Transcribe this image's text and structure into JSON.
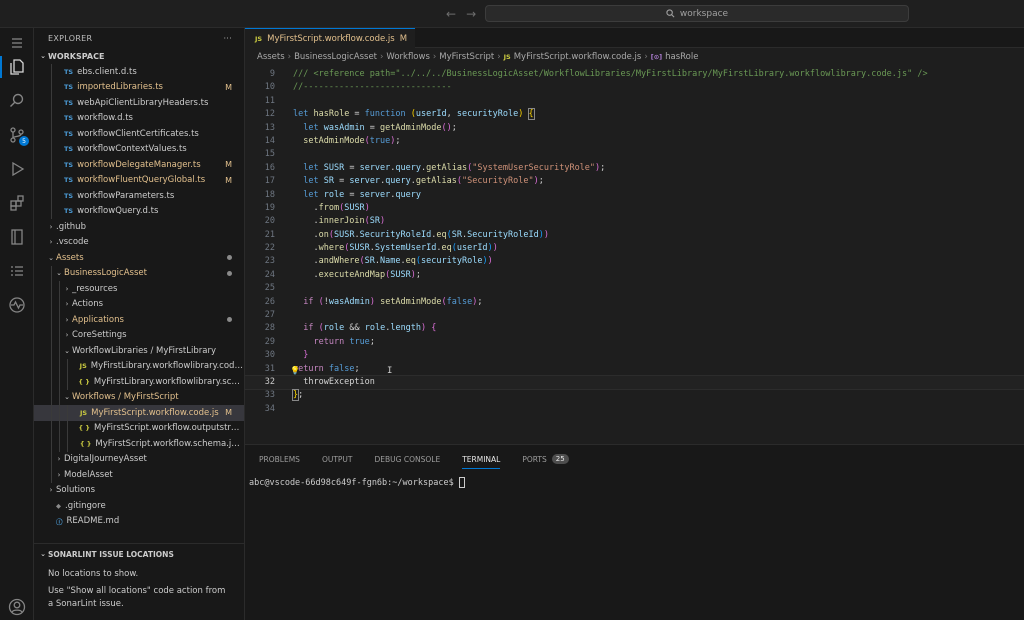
{
  "titlebar": {
    "search_text": "workspace"
  },
  "activity": {
    "scm_badge": "5"
  },
  "explorer": {
    "title": "EXPLORER",
    "more": "···",
    "workspace_label": "WORKSPACE",
    "rows": [
      {
        "name": "ebs.client.d.ts",
        "icon": "TS",
        "kind": "ts",
        "depth": 2,
        "chev": ""
      },
      {
        "name": "importedLibraries.ts",
        "icon": "TS",
        "kind": "ts",
        "depth": 2,
        "chev": "",
        "deco": "M",
        "modified": true
      },
      {
        "name": "webApiClientLibraryHeaders.ts",
        "icon": "TS",
        "kind": "ts",
        "depth": 2,
        "chev": ""
      },
      {
        "name": "workflow.d.ts",
        "icon": "TS",
        "kind": "ts",
        "depth": 2,
        "chev": ""
      },
      {
        "name": "workflowClientCertificates.ts",
        "icon": "TS",
        "kind": "ts",
        "depth": 2,
        "chev": ""
      },
      {
        "name": "workflowContextValues.ts",
        "icon": "TS",
        "kind": "ts",
        "depth": 2,
        "chev": ""
      },
      {
        "name": "workflowDelegateManager.ts",
        "icon": "TS",
        "kind": "ts",
        "depth": 2,
        "chev": "",
        "deco": "M",
        "modified": true
      },
      {
        "name": "workflowFluentQueryGlobal.ts",
        "icon": "TS",
        "kind": "ts",
        "depth": 2,
        "chev": "",
        "deco": "M",
        "modified": true
      },
      {
        "name": "workflowParameters.ts",
        "icon": "TS",
        "kind": "ts",
        "depth": 2,
        "chev": ""
      },
      {
        "name": "workflowQuery.d.ts",
        "icon": "TS",
        "kind": "ts",
        "depth": 2,
        "chev": ""
      },
      {
        "name": ".github",
        "icon": "",
        "kind": "folder",
        "depth": 1,
        "chev": "›"
      },
      {
        "name": ".vscode",
        "icon": "",
        "kind": "folder",
        "depth": 1,
        "chev": "›"
      },
      {
        "name": "Assets",
        "icon": "",
        "kind": "folder",
        "depth": 1,
        "chev": "⌄",
        "dot": true,
        "modified": true
      },
      {
        "name": "BusinessLogicAsset",
        "icon": "",
        "kind": "folder",
        "depth": 2,
        "chev": "⌄",
        "dot": true,
        "modified": true
      },
      {
        "name": "_resources",
        "icon": "",
        "kind": "folder",
        "depth": 3,
        "chev": "›"
      },
      {
        "name": "Actions",
        "icon": "",
        "kind": "folder",
        "depth": 3,
        "chev": "›"
      },
      {
        "name": "Applications",
        "icon": "",
        "kind": "folder",
        "depth": 3,
        "chev": "›",
        "dot": true,
        "modified": true
      },
      {
        "name": "CoreSettings",
        "icon": "",
        "kind": "folder",
        "depth": 3,
        "chev": "›"
      },
      {
        "name": "WorkflowLibraries / MyFirstLibrary",
        "icon": "",
        "kind": "folder",
        "depth": 3,
        "chev": "⌄"
      },
      {
        "name": "MyFirstLibrary.workflowlibrary.code.js",
        "icon": "JS",
        "kind": "js",
        "depth": 4,
        "chev": ""
      },
      {
        "name": "MyFirstLibrary.workflowlibrary.schema.js...",
        "icon": "{ }",
        "kind": "json",
        "depth": 4,
        "chev": ""
      },
      {
        "name": "Workflows / MyFirstScript",
        "icon": "",
        "kind": "folder",
        "depth": 3,
        "chev": "⌄",
        "modified": true
      },
      {
        "name": "MyFirstScript.workflow.code.js",
        "icon": "JS",
        "kind": "js",
        "depth": 4,
        "chev": "",
        "deco": "M",
        "modified": true,
        "selected": true
      },
      {
        "name": "MyFirstScript.workflow.outputstructurec...",
        "icon": "{ }",
        "kind": "json",
        "depth": 4,
        "chev": ""
      },
      {
        "name": "MyFirstScript.workflow.schema.json",
        "icon": "{ }",
        "kind": "json",
        "depth": 4,
        "chev": ""
      },
      {
        "name": "DigitalJourneyAsset",
        "icon": "",
        "kind": "folder",
        "depth": 2,
        "chev": "›"
      },
      {
        "name": "ModelAsset",
        "icon": "",
        "kind": "folder",
        "depth": 2,
        "chev": "›"
      },
      {
        "name": "Solutions",
        "icon": "",
        "kind": "folder",
        "depth": 1,
        "chev": "›"
      },
      {
        "name": ".gitingore",
        "icon": "◆",
        "kind": "git",
        "depth": 1,
        "chev": ""
      },
      {
        "name": "README.md",
        "icon": "ⓘ",
        "kind": "info",
        "depth": 1,
        "chev": ""
      }
    ]
  },
  "sonar": {
    "title": "SONARLINT ISSUE LOCATIONS",
    "line1": "No locations to show.",
    "line2": "Use \"Show all locations\" code action from a SonarLint issue."
  },
  "editor": {
    "tab": {
      "icon": "JS",
      "label": "MyFirstScript.workflow.code.js",
      "status": "M",
      "close": ""
    },
    "breadcrumb": [
      "Assets",
      "BusinessLogicAsset",
      "Workflows",
      "MyFirstScript",
      "MyFirstScript.workflow.code.js",
      "hasRole"
    ],
    "breadcrumb_icons": [
      "JS",
      "[⊙]"
    ],
    "current_line": 32,
    "lines": [
      {
        "n": 9,
        "t": "<span class=\"cm\">/// &lt;reference path=\"../../../BusinessLogicAsset/WorkflowLibraries/MyFirstLibrary/MyFirstLibrary.workflowlibrary.code.js\" /&gt;</span>"
      },
      {
        "n": 10,
        "t": "<span class=\"cm\">//-----------------------------</span>"
      },
      {
        "n": 11,
        "t": ""
      },
      {
        "n": 12,
        "t": "<span class=\"k\">let</span> <span class=\"f\">hasRole</span> = <span class=\"k\">function</span> <span class=\"b1\">(</span><span class=\"v\">userId</span>, <span class=\"v\">securityRole</span><span class=\"b1\">)</span> <span class=\"b1\" style=\"outline:1px solid #888\">{</span>"
      },
      {
        "n": 13,
        "t": "  <span class=\"k\">let</span> <span class=\"v\">wasAdmin</span> = <span class=\"f\">getAdminMode</span><span class=\"b2\">()</span>;"
      },
      {
        "n": 14,
        "t": "  <span class=\"f\">setAdminMode</span><span class=\"b2\">(</span><span class=\"k\">true</span><span class=\"b2\">)</span>;"
      },
      {
        "n": 15,
        "t": ""
      },
      {
        "n": 16,
        "t": "  <span class=\"k\">let</span> <span class=\"v\">SUSR</span> = <span class=\"v\">server</span>.<span class=\"v\">query</span>.<span class=\"f\">getAlias</span><span class=\"b2\">(</span><span class=\"s\">\"SystemUserSecurityRole\"</span><span class=\"b2\">)</span>;"
      },
      {
        "n": 17,
        "t": "  <span class=\"k\">let</span> <span class=\"v\">SR</span> = <span class=\"v\">server</span>.<span class=\"v\">query</span>.<span class=\"f\">getAlias</span><span class=\"b2\">(</span><span class=\"s\">\"SecurityRole\"</span><span class=\"b2\">)</span>;"
      },
      {
        "n": 18,
        "t": "  <span class=\"k\">let</span> <span class=\"v\">role</span> = <span class=\"v\">server</span>.<span class=\"v\">query</span>"
      },
      {
        "n": 19,
        "t": "    .<span class=\"f\">from</span><span class=\"b2\">(</span><span class=\"v\">SUSR</span><span class=\"b2\">)</span>"
      },
      {
        "n": 20,
        "t": "    .<span class=\"f\">innerJoin</span><span class=\"b2\">(</span><span class=\"v\">SR</span><span class=\"b2\">)</span>"
      },
      {
        "n": 21,
        "t": "    .<span class=\"f\">on</span><span class=\"b2\">(</span><span class=\"v\">SUSR</span>.<span class=\"v\">SecurityRoleId</span>.<span class=\"f\">eq</span><span class=\"b3\">(</span><span class=\"v\">SR</span>.<span class=\"v\">SecurityRoleId</span><span class=\"b3\">)</span><span class=\"b2\">)</span>"
      },
      {
        "n": 22,
        "t": "    .<span class=\"f\">where</span><span class=\"b2\">(</span><span class=\"v\">SUSR</span>.<span class=\"v\">SystemUserId</span>.<span class=\"f\">eq</span><span class=\"b3\">(</span><span class=\"v\">userId</span><span class=\"b3\">)</span><span class=\"b2\">)</span>"
      },
      {
        "n": 23,
        "t": "    .<span class=\"f\">andWhere</span><span class=\"b2\">(</span><span class=\"v\">SR</span>.<span class=\"v\">Name</span>.<span class=\"f\">eq</span><span class=\"b3\">(</span><span class=\"v\">securityRole</span><span class=\"b3\">)</span><span class=\"b2\">)</span>"
      },
      {
        "n": 24,
        "t": "    .<span class=\"f\">executeAndMap</span><span class=\"b2\">(</span><span class=\"v\">SUSR</span><span class=\"b2\">)</span>;"
      },
      {
        "n": 25,
        "t": ""
      },
      {
        "n": 26,
        "t": "  <span class=\"kc\">if</span> <span class=\"b2\">(</span>!<span class=\"v\">wasAdmin</span><span class=\"b2\">)</span> <span class=\"f\">setAdminMode</span><span class=\"b2\">(</span><span class=\"k\">false</span><span class=\"b2\">)</span>;"
      },
      {
        "n": 27,
        "t": ""
      },
      {
        "n": 28,
        "t": "  <span class=\"kc\">if</span> <span class=\"b2\">(</span><span class=\"v\">role</span> &amp;&amp; <span class=\"v\">role</span>.<span class=\"v\">length</span><span class=\"b2\">)</span> <span class=\"b2\">{</span>"
      },
      {
        "n": 29,
        "t": "    <span class=\"kc\">return</span> <span class=\"k\">true</span>;"
      },
      {
        "n": 30,
        "t": "  <span class=\"b2\">}</span>"
      },
      {
        "n": 31,
        "t": "<span class=\"kc\">return</span> <span class=\"k\">false</span>;"
      },
      {
        "n": 32,
        "t": "  throwException"
      },
      {
        "n": 33,
        "t": "<span class=\"b1\" style=\"outline:1px solid #888\">}</span>;"
      },
      {
        "n": 34,
        "t": ""
      }
    ]
  },
  "panel": {
    "tabs": [
      "PROBLEMS",
      "OUTPUT",
      "DEBUG CONSOLE",
      "TERMINAL",
      "PORTS"
    ],
    "active_tab": "TERMINAL",
    "ports_badge": "25",
    "terminal_prompt": "abc@vscode-66d98c649f-fgn6b:~/workspace$"
  },
  "colors": {
    "accent": "#0078d4",
    "modified": "#e2c08d",
    "background": "#1e1e1e",
    "sidebar": "#181818"
  }
}
